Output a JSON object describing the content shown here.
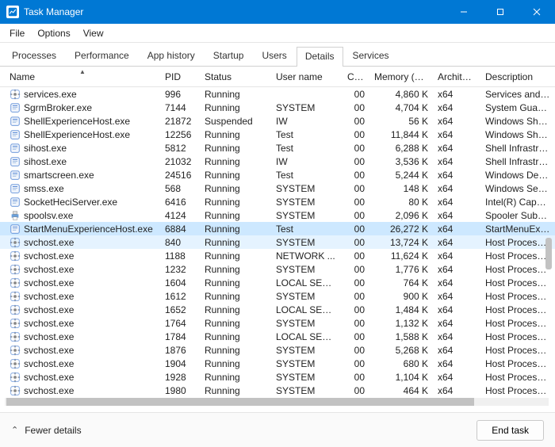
{
  "title": "Task Manager",
  "menu": [
    "File",
    "Options",
    "View"
  ],
  "tabs": [
    "Processes",
    "Performance",
    "App history",
    "Startup",
    "Users",
    "Details",
    "Services"
  ],
  "active_tab": 5,
  "columns": [
    {
      "label": "Name",
      "sort": true
    },
    {
      "label": "PID"
    },
    {
      "label": "Status"
    },
    {
      "label": "User name"
    },
    {
      "label": "CPU"
    },
    {
      "label": "Memory (ac..."
    },
    {
      "label": "Architec..."
    },
    {
      "label": "Description"
    }
  ],
  "rows": [
    {
      "icon": "gear",
      "name": "services.exe",
      "pid": "996",
      "status": "Running",
      "user": "",
      "cpu": "00",
      "mem": "4,860 K",
      "arch": "x64",
      "desc": "Services and Con"
    },
    {
      "icon": "app",
      "name": "SgrmBroker.exe",
      "pid": "7144",
      "status": "Running",
      "user": "SYSTEM",
      "cpu": "00",
      "mem": "4,704 K",
      "arch": "x64",
      "desc": "System Guard Ru"
    },
    {
      "icon": "app",
      "name": "ShellExperienceHost.exe",
      "pid": "21872",
      "status": "Suspended",
      "user": "IW",
      "cpu": "00",
      "mem": "56 K",
      "arch": "x64",
      "desc": "Windows Shell Ex"
    },
    {
      "icon": "app",
      "name": "ShellExperienceHost.exe",
      "pid": "12256",
      "status": "Running",
      "user": "Test",
      "cpu": "00",
      "mem": "11,844 K",
      "arch": "x64",
      "desc": "Windows Shell Ex"
    },
    {
      "icon": "app",
      "name": "sihost.exe",
      "pid": "5812",
      "status": "Running",
      "user": "Test",
      "cpu": "00",
      "mem": "6,288 K",
      "arch": "x64",
      "desc": "Shell Infrastructur"
    },
    {
      "icon": "app",
      "name": "sihost.exe",
      "pid": "21032",
      "status": "Running",
      "user": "IW",
      "cpu": "00",
      "mem": "3,536 K",
      "arch": "x64",
      "desc": "Shell Infrastructur"
    },
    {
      "icon": "app",
      "name": "smartscreen.exe",
      "pid": "24516",
      "status": "Running",
      "user": "Test",
      "cpu": "00",
      "mem": "5,244 K",
      "arch": "x64",
      "desc": "Windows Defend"
    },
    {
      "icon": "app",
      "name": "smss.exe",
      "pid": "568",
      "status": "Running",
      "user": "SYSTEM",
      "cpu": "00",
      "mem": "148 K",
      "arch": "x64",
      "desc": "Windows Session"
    },
    {
      "icon": "app",
      "name": "SocketHeciServer.exe",
      "pid": "6416",
      "status": "Running",
      "user": "SYSTEM",
      "cpu": "00",
      "mem": "80 K",
      "arch": "x64",
      "desc": "Intel(R) Capability"
    },
    {
      "icon": "printer",
      "name": "spoolsv.exe",
      "pid": "4124",
      "status": "Running",
      "user": "SYSTEM",
      "cpu": "00",
      "mem": "2,096 K",
      "arch": "x64",
      "desc": "Spooler SubSyste"
    },
    {
      "icon": "app",
      "name": "StartMenuExperienceHost.exe",
      "pid": "6884",
      "status": "Running",
      "user": "Test",
      "cpu": "00",
      "mem": "26,272 K",
      "arch": "x64",
      "desc": "StartMenuExperie",
      "sel": "selected"
    },
    {
      "icon": "gear",
      "name": "svchost.exe",
      "pid": "840",
      "status": "Running",
      "user": "SYSTEM",
      "cpu": "00",
      "mem": "13,724 K",
      "arch": "x64",
      "desc": "Host Process for \\",
      "sel": "semi"
    },
    {
      "icon": "gear",
      "name": "svchost.exe",
      "pid": "1188",
      "status": "Running",
      "user": "NETWORK ...",
      "cpu": "00",
      "mem": "11,624 K",
      "arch": "x64",
      "desc": "Host Process for \\"
    },
    {
      "icon": "gear",
      "name": "svchost.exe",
      "pid": "1232",
      "status": "Running",
      "user": "SYSTEM",
      "cpu": "00",
      "mem": "1,776 K",
      "arch": "x64",
      "desc": "Host Process for \\"
    },
    {
      "icon": "gear",
      "name": "svchost.exe",
      "pid": "1604",
      "status": "Running",
      "user": "LOCAL SERV...",
      "cpu": "00",
      "mem": "764 K",
      "arch": "x64",
      "desc": "Host Process for \\"
    },
    {
      "icon": "gear",
      "name": "svchost.exe",
      "pid": "1612",
      "status": "Running",
      "user": "SYSTEM",
      "cpu": "00",
      "mem": "900 K",
      "arch": "x64",
      "desc": "Host Process for \\"
    },
    {
      "icon": "gear",
      "name": "svchost.exe",
      "pid": "1652",
      "status": "Running",
      "user": "LOCAL SERV...",
      "cpu": "00",
      "mem": "1,484 K",
      "arch": "x64",
      "desc": "Host Process for \\"
    },
    {
      "icon": "gear",
      "name": "svchost.exe",
      "pid": "1764",
      "status": "Running",
      "user": "SYSTEM",
      "cpu": "00",
      "mem": "1,132 K",
      "arch": "x64",
      "desc": "Host Process for \\"
    },
    {
      "icon": "gear",
      "name": "svchost.exe",
      "pid": "1784",
      "status": "Running",
      "user": "LOCAL SERV...",
      "cpu": "00",
      "mem": "1,588 K",
      "arch": "x64",
      "desc": "Host Process for \\"
    },
    {
      "icon": "gear",
      "name": "svchost.exe",
      "pid": "1876",
      "status": "Running",
      "user": "SYSTEM",
      "cpu": "00",
      "mem": "5,268 K",
      "arch": "x64",
      "desc": "Host Process for \\"
    },
    {
      "icon": "gear",
      "name": "svchost.exe",
      "pid": "1904",
      "status": "Running",
      "user": "SYSTEM",
      "cpu": "00",
      "mem": "680 K",
      "arch": "x64",
      "desc": "Host Process for \\"
    },
    {
      "icon": "gear",
      "name": "svchost.exe",
      "pid": "1928",
      "status": "Running",
      "user": "SYSTEM",
      "cpu": "00",
      "mem": "1,104 K",
      "arch": "x64",
      "desc": "Host Process for \\"
    },
    {
      "icon": "gear",
      "name": "svchost.exe",
      "pid": "1980",
      "status": "Running",
      "user": "SYSTEM",
      "cpu": "00",
      "mem": "464 K",
      "arch": "x64",
      "desc": "Host Process for \\"
    }
  ],
  "footer": {
    "fewer": "Fewer details",
    "endtask": "End task"
  }
}
